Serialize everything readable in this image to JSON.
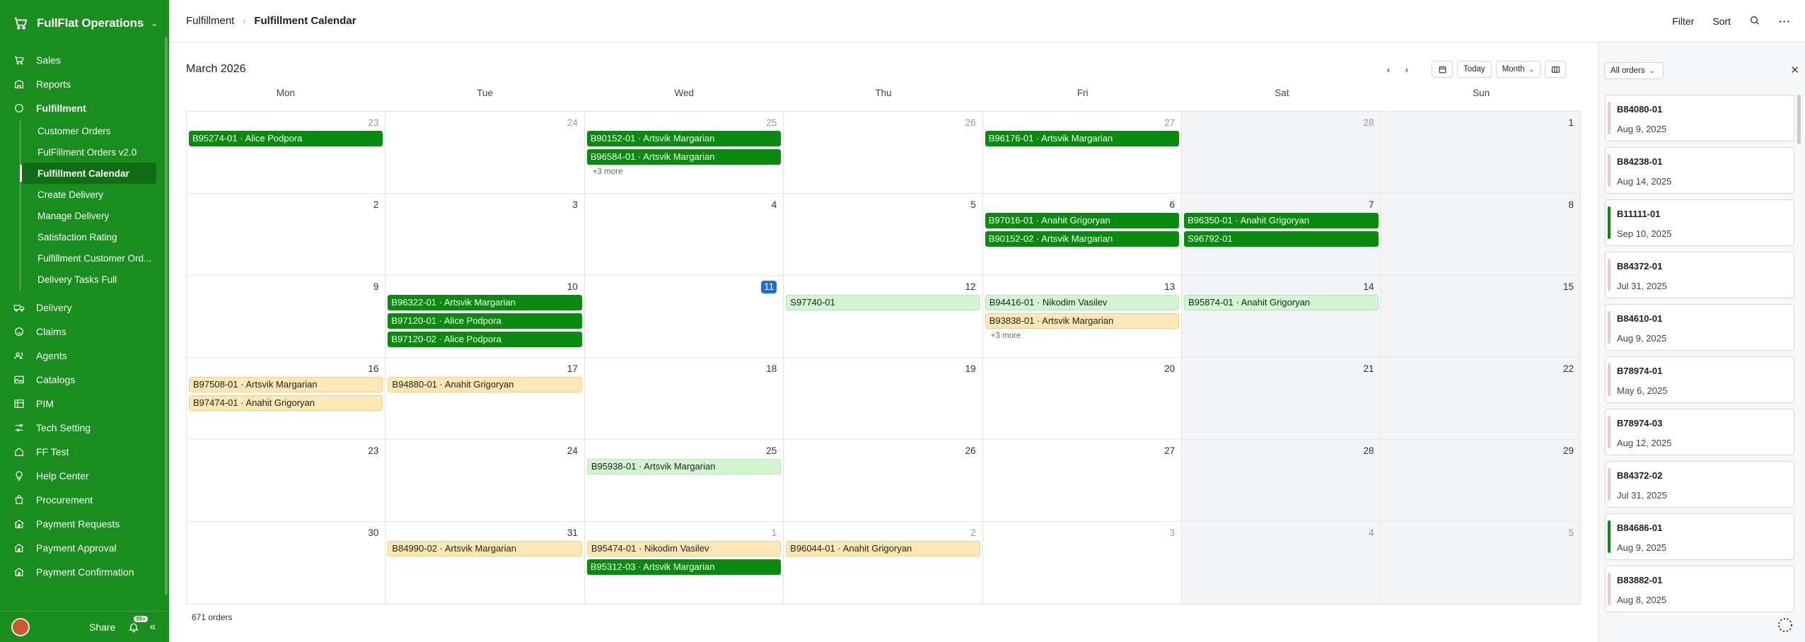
{
  "app": {
    "title": "FullFlat Operations"
  },
  "sidebar": {
    "items": [
      {
        "label": "Sales",
        "icon": "cart-icon"
      },
      {
        "label": "Reports",
        "icon": "building-icon"
      },
      {
        "label": "Fulfillment",
        "icon": "circle-icon"
      },
      {
        "label": "Delivery",
        "icon": "truck-icon"
      },
      {
        "label": "Claims",
        "icon": "smile-icon"
      },
      {
        "label": "Agents",
        "icon": "people-icon"
      },
      {
        "label": "Catalogs",
        "icon": "image-icon"
      },
      {
        "label": "PIM",
        "icon": "grid-icon"
      },
      {
        "label": "Tech Setting",
        "icon": "sliders-icon"
      },
      {
        "label": "FF Test",
        "icon": "home-icon"
      },
      {
        "label": "Help Center",
        "icon": "bulb-icon"
      },
      {
        "label": "Procurement",
        "icon": "bag-icon"
      },
      {
        "label": "Payment Requests",
        "icon": "house-money-icon"
      },
      {
        "label": "Payment Approval",
        "icon": "house-money-icon"
      },
      {
        "label": "Payment Confirmation",
        "icon": "house-money-icon"
      }
    ],
    "fulfillment_sub": [
      "Customer Orders",
      "FulFillment Orders v2.0",
      "Fulfillment Calendar",
      "Create Delivery",
      "Manage Delivery",
      "Satisfaction Rating",
      "Fulfillment Customer Ord...",
      "Delivery Tasks Full"
    ],
    "share_label": "Share",
    "notif_badge": "99+"
  },
  "topbar": {
    "breadcrumb_parent": "Fulfillment",
    "breadcrumb_current": "Fulfillment Calendar",
    "filter_label": "Filter",
    "sort_label": "Sort"
  },
  "calendar": {
    "month": "March",
    "year": "2026",
    "today_label": "Today",
    "view_label": "Month",
    "weekdays": [
      "Mon",
      "Tue",
      "Wed",
      "Thu",
      "Fri",
      "Sat",
      "Sun"
    ],
    "weeks": [
      [
        {
          "d": "23",
          "m": true,
          "ev": [
            {
              "t": "B95274-01 · Alice Podpora",
              "s": "green"
            }
          ]
        },
        {
          "d": "24",
          "m": true,
          "ev": []
        },
        {
          "d": "25",
          "m": true,
          "ev": [
            {
              "t": "B90152-01 · Artsvik Margarian",
              "s": "green"
            },
            {
              "t": "B96584-01 · Artsvik Margarian",
              "s": "green"
            }
          ],
          "more": "+3 more"
        },
        {
          "d": "26",
          "m": true,
          "ev": []
        },
        {
          "d": "27",
          "m": true,
          "ev": [
            {
              "t": "B96176-01 · Artsvik Margarian",
              "s": "green"
            }
          ]
        },
        {
          "d": "28",
          "m": true,
          "ev": []
        },
        {
          "d": "1",
          "ev": []
        }
      ],
      [
        {
          "d": "2",
          "ev": []
        },
        {
          "d": "3",
          "ev": []
        },
        {
          "d": "4",
          "ev": []
        },
        {
          "d": "5",
          "ev": []
        },
        {
          "d": "6",
          "ev": [
            {
              "t": "B97016-01 · Anahit Grigoryan",
              "s": "green"
            },
            {
              "t": "B90152-02 · Artsvik Margarian",
              "s": "green"
            }
          ]
        },
        {
          "d": "7",
          "ev": [
            {
              "t": "B96350-01 · Anahit Grigoryan",
              "s": "green"
            },
            {
              "t": "S96792-01",
              "s": "green"
            }
          ]
        },
        {
          "d": "8",
          "ev": []
        }
      ],
      [
        {
          "d": "9",
          "ev": []
        },
        {
          "d": "10",
          "ev": [
            {
              "t": "B96322-01 · Artsvik Margarian",
              "s": "green"
            },
            {
              "t": "B97120-01 · Alice Podpora",
              "s": "green"
            },
            {
              "t": "B97120-02 · Alice Podpora",
              "s": "green"
            }
          ]
        },
        {
          "d": "11",
          "today": true,
          "ev": []
        },
        {
          "d": "12",
          "ev": [
            {
              "t": "S97740-01",
              "s": "light"
            }
          ]
        },
        {
          "d": "13",
          "ev": [
            {
              "t": "B94416-01 · Nikodim Vasilev",
              "s": "light"
            },
            {
              "t": "B93838-01 · Artsvik Margarian",
              "s": "amber"
            }
          ],
          "more": "+3 more"
        },
        {
          "d": "14",
          "ev": [
            {
              "t": "B95874-01 · Anahit Grigoryan",
              "s": "light"
            }
          ]
        },
        {
          "d": "15",
          "ev": []
        }
      ],
      [
        {
          "d": "16",
          "ev": [
            {
              "t": "B97508-01 · Artsvik Margarian",
              "s": "amber"
            },
            {
              "t": "B97474-01 · Anahit Grigoryan",
              "s": "amber"
            }
          ]
        },
        {
          "d": "17",
          "ev": [
            {
              "t": "B94880-01 · Anahit Grigoryan",
              "s": "amber"
            }
          ]
        },
        {
          "d": "18",
          "ev": []
        },
        {
          "d": "19",
          "ev": []
        },
        {
          "d": "20",
          "ev": []
        },
        {
          "d": "21",
          "ev": []
        },
        {
          "d": "22",
          "ev": []
        }
      ],
      [
        {
          "d": "23",
          "ev": []
        },
        {
          "d": "24",
          "ev": []
        },
        {
          "d": "25",
          "ev": [
            {
              "t": "B95938-01 · Artsvik Margarian",
              "s": "light"
            }
          ]
        },
        {
          "d": "26",
          "ev": []
        },
        {
          "d": "27",
          "ev": []
        },
        {
          "d": "28",
          "ev": []
        },
        {
          "d": "29",
          "ev": []
        }
      ],
      [
        {
          "d": "30",
          "ev": []
        },
        {
          "d": "31",
          "ev": [
            {
              "t": "B84990-02 · Artsvik Margarian",
              "s": "amber"
            }
          ]
        },
        {
          "d": "1",
          "m": true,
          "ev": [
            {
              "t": "B95474-01 · Nikodim Vasilev",
              "s": "amber"
            },
            {
              "t": "B95312-03 · Artsvik Margarian",
              "s": "green"
            }
          ]
        },
        {
          "d": "2",
          "m": true,
          "ev": [
            {
              "t": "B96044-01 · Anahit Grigoryan",
              "s": "amber"
            }
          ]
        },
        {
          "d": "3",
          "m": true,
          "ev": []
        },
        {
          "d": "4",
          "m": true,
          "ev": []
        },
        {
          "d": "5",
          "m": true,
          "ev": []
        }
      ]
    ],
    "order_count": "671 orders"
  },
  "panel": {
    "filter_label": "All orders",
    "cards": [
      {
        "id": "B84080-01",
        "date": "Aug 9, 2025",
        "s": "pink"
      },
      {
        "id": "B84238-01",
        "date": "Aug 14, 2025",
        "s": "pink"
      },
      {
        "id": "B11111-01",
        "date": "Sep 10, 2025",
        "s": "green"
      },
      {
        "id": "B84372-01",
        "date": "Jul 31, 2025",
        "s": "pink"
      },
      {
        "id": "B84610-01",
        "date": "Aug 9, 2025",
        "s": "pink"
      },
      {
        "id": "B78974-01",
        "date": "May 6, 2025",
        "s": "pink"
      },
      {
        "id": "B78974-03",
        "date": "Aug 12, 2025",
        "s": "pink"
      },
      {
        "id": "B84372-02",
        "date": "Jul 31, 2025",
        "s": "pink"
      },
      {
        "id": "B84686-01",
        "date": "Aug 9, 2025",
        "s": "green"
      },
      {
        "id": "B83882-01",
        "date": "Aug 8, 2025",
        "s": "pink"
      }
    ]
  },
  "colors": {
    "brand": "#1a8d1f",
    "event_green": "#0b8a10",
    "event_light": "#d2f5d2",
    "event_amber": "#fde7b4",
    "today": "#1a6fd1"
  }
}
